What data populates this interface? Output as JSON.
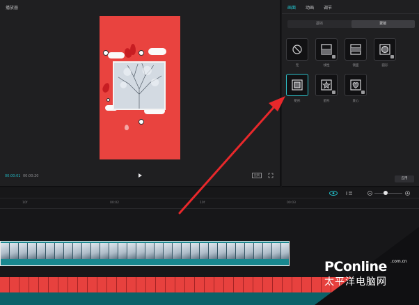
{
  "player": {
    "title": "播放器",
    "time_current": "00:00:01",
    "time_total": "00:00:20",
    "ratio_label": "比例"
  },
  "side": {
    "tabs": [
      {
        "label": "画面",
        "active": true
      },
      {
        "label": "动画",
        "active": false
      },
      {
        "label": "调节",
        "active": false
      }
    ],
    "segments": [
      {
        "label": "基础",
        "active": false
      },
      {
        "label": "蒙版",
        "active": true
      }
    ],
    "masks": [
      {
        "label": "无",
        "icon": "none-icon"
      },
      {
        "label": "线性",
        "icon": "linear-icon"
      },
      {
        "label": "镜面",
        "icon": "mirror-icon"
      },
      {
        "label": "圆形",
        "icon": "circle-icon"
      },
      {
        "label": "矩形",
        "icon": "rectangle-icon",
        "selected": true
      },
      {
        "label": "星形",
        "icon": "star-icon"
      },
      {
        "label": "爱心",
        "icon": "heart-icon"
      }
    ],
    "apply_label": "应用"
  },
  "timeline": {
    "ticks": [
      "10f",
      "00:02",
      "10f",
      "00:03"
    ]
  },
  "watermark": {
    "brand": "PConline",
    "domain": ".com.cn",
    "tagline": "太平洋电脑网"
  },
  "colors": {
    "accent": "#22c4cf",
    "arrow": "#e8282b",
    "canvas": "#e9433f"
  }
}
